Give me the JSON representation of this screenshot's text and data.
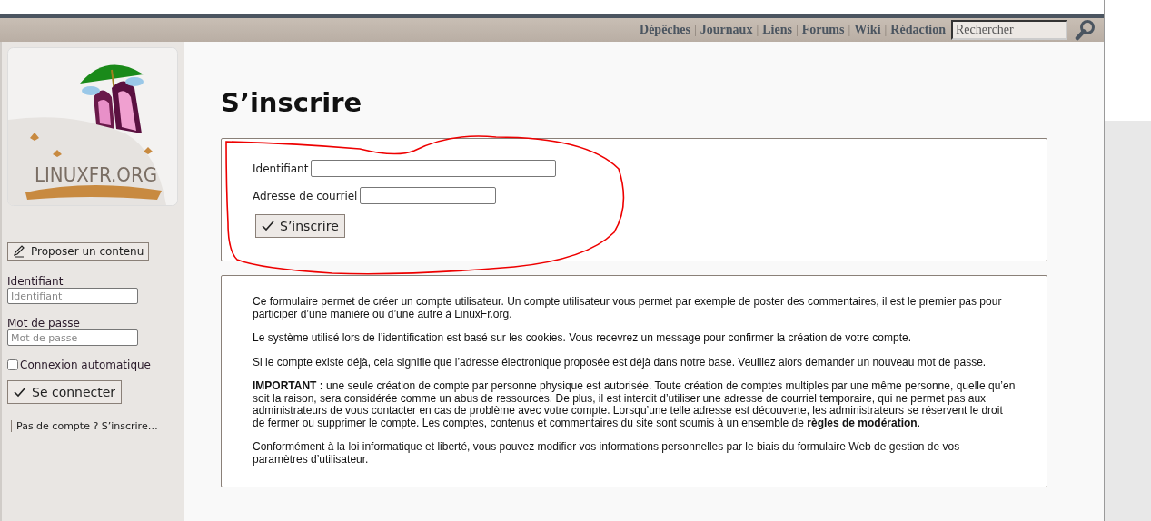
{
  "nav": {
    "links": [
      {
        "label": "Dépêches"
      },
      {
        "label": "Journaux"
      },
      {
        "label": "Liens"
      },
      {
        "label": "Forums"
      },
      {
        "label": "Wiki"
      },
      {
        "label": "Rédaction"
      }
    ],
    "separator": "|",
    "search": {
      "placeholder": "Rechercher"
    }
  },
  "sidebar": {
    "logo_text": "LINUXFR.ORG",
    "propose_button": "Proposer un contenu",
    "login": {
      "username_label": "Identifiant",
      "username_placeholder": "Identifiant",
      "password_label": "Mot de passe",
      "password_placeholder": "Mot de passe",
      "remember": {
        "label": "Connexion automatique",
        "checked": false
      },
      "submit": "Se connecter"
    },
    "signup_link": "Pas de compte ? S’inscrire…"
  },
  "main": {
    "title": "S’inscrire",
    "form": {
      "fields": [
        {
          "label": "Identifiant",
          "kind": "wide"
        },
        {
          "label": "Adresse de courriel",
          "kind": "narrow"
        }
      ],
      "submit": "S’inscrire",
      "annotated": true
    },
    "info": [
      "Ce formulaire permet de créer un compte utilisateur. Un compte utilisateur vous permet par exemple de poster des commentaires, il est le premier pas pour participer d’une manière ou d’une autre à LinuxFr.org.",
      "Le système utilisé lors de l’identification est basé sur les cookies. Vous recevrez un message pour confirmer la création de votre compte.",
      "Si le compte existe déjà, cela signifie que l’adresse électronique proposée est déjà dans notre base. Veuillez alors demander un nouveau mot de passe.",
      "**IMPORTANT :** une seule création de compte par personne physique est autorisée. Toute création de comptes multiples par une même personne, quelle qu’en soit la raison, sera considérée comme un abus de ressources. De plus, il est interdit d’utiliser une adresse de courriel temporaire, qui ne permet pas aux administrateurs de vous contacter en cas de problème avec votre compte. Lorsqu’une telle adresse est découverte, les administrateurs se réservent le droit de fermer ou supprimer le compte. Les comptes, contenus et commentaires du site sont soumis à un ensemble de **règles de modération**.",
      "Conformément à la loi informatique et liberté, vous pouvez modifier vos informations personnelles par le biais du formulaire Web de gestion de vos paramètres d’utilisateur."
    ]
  }
}
